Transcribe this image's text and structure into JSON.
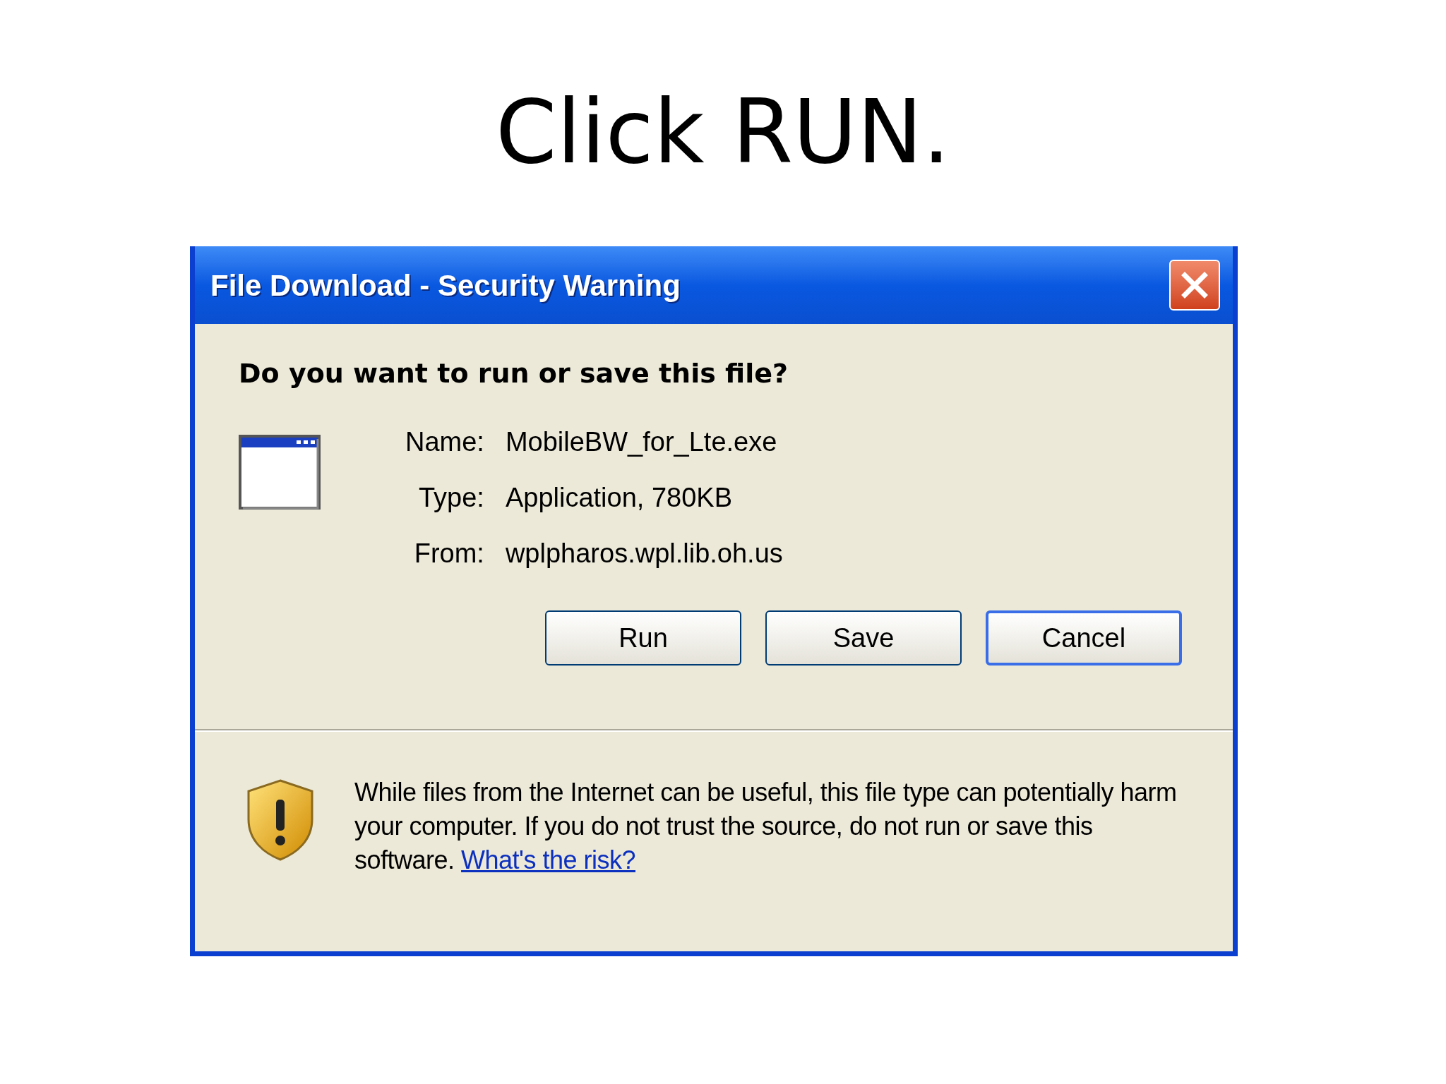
{
  "slide_title": "Click RUN.",
  "dialog": {
    "title": "File Download - Security Warning",
    "heading": "Do you want to run or save this file?",
    "file_info": [
      {
        "label": "Name:",
        "value": "MobileBW_for_Lte.exe"
      },
      {
        "label": "Type:",
        "value": "Application, 780KB"
      },
      {
        "label": "From:",
        "value": "wplpharos.wpl.lib.oh.us"
      }
    ],
    "buttons": [
      {
        "label": "Run",
        "focused": false
      },
      {
        "label": "Save",
        "focused": false
      },
      {
        "label": "Cancel",
        "focused": true
      }
    ],
    "warning": {
      "text": "While files from the Internet can be useful, this file type can potentially harm your computer. If you do not trust the source, do not run or save this software.",
      "link": "What's the risk?"
    }
  }
}
